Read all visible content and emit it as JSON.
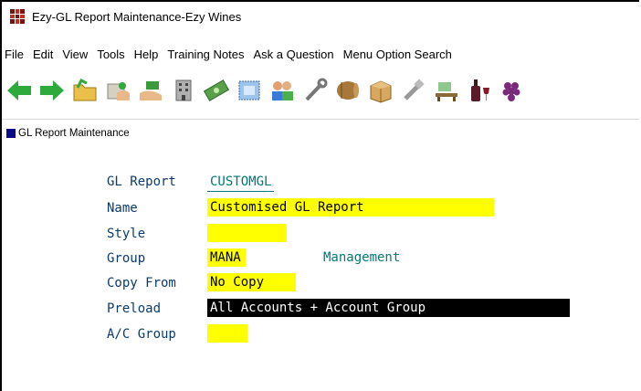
{
  "window": {
    "title": "Ezy-GL Report Maintenance-Ezy Wines"
  },
  "menu": [
    "File",
    "Edit",
    "View",
    "Tools",
    "Help",
    "Training Notes",
    "Ask a Question",
    "Menu Option Search"
  ],
  "toolbar": {
    "icons": [
      "back-arrow-icon",
      "forward-arrow-icon",
      "folder-open-icon",
      "folder-hand-icon",
      "hand-money-icon",
      "building-icon",
      "money-icon",
      "stamp-icon",
      "people-icon",
      "wrench-icon",
      "barrel-icon",
      "box-icon",
      "tool-icon",
      "desk-icon",
      "wine-bottle-icon",
      "grapes-icon"
    ]
  },
  "subwindow": {
    "title": "GL Report Maintenance"
  },
  "form": {
    "gl_report": {
      "label": "GL Report",
      "value": "CUSTOMGL"
    },
    "name": {
      "label": "Name",
      "value": "Customised GL Report"
    },
    "style": {
      "label": "Style",
      "value": ""
    },
    "group": {
      "label": "Group",
      "value": "MANA",
      "description": "Management"
    },
    "copy_from": {
      "label": "Copy From",
      "value": "No Copy"
    },
    "preload": {
      "label": "Preload",
      "value": "All Accounts + Account Group"
    },
    "ac_group": {
      "label": "A/C Group",
      "value": ""
    }
  },
  "colors": {
    "field_bg": "#ffff00",
    "label": "#0a3c6e",
    "accent": "#007878",
    "selected_bg": "#000000"
  }
}
